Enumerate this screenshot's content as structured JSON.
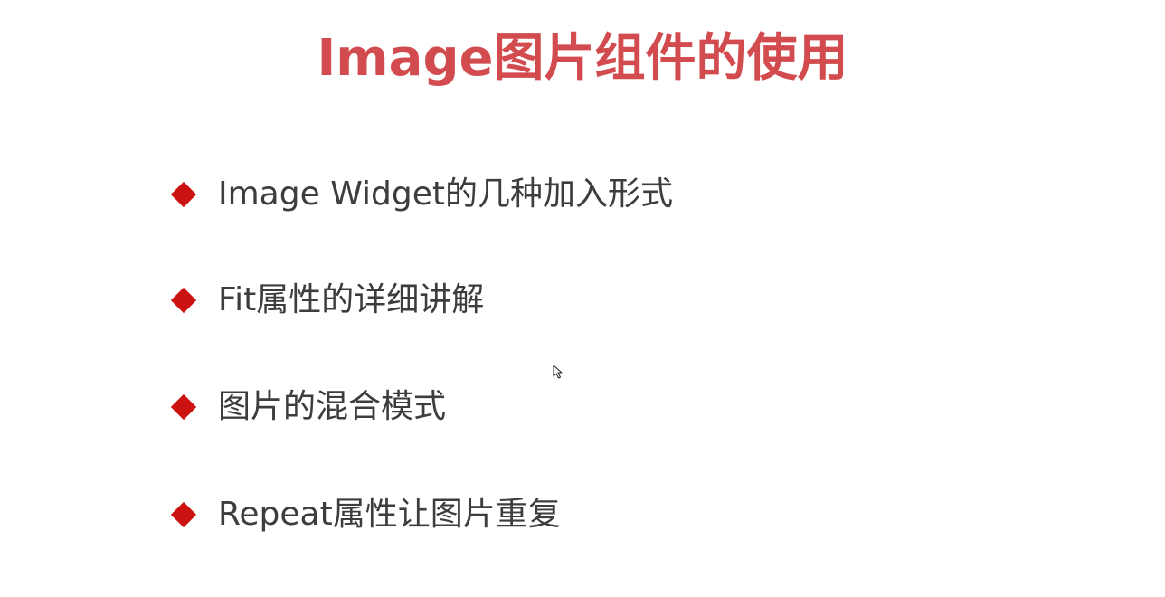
{
  "colors": {
    "title": "#d24b4f",
    "bullet_marker": "#cc1111",
    "bullet_text": "#3d3d3d",
    "background": "#ffffff"
  },
  "slide": {
    "title": "Image图片组件的使用",
    "bullets": [
      {
        "text": "Image Widget的几种加入形式",
        "icon": "diamond-bullet-icon"
      },
      {
        "text": "Fit属性的详细讲解",
        "icon": "diamond-bullet-icon"
      },
      {
        "text": "图片的混合模式",
        "icon": "diamond-bullet-icon"
      },
      {
        "text": "Repeat属性让图片重复",
        "icon": "diamond-bullet-icon"
      }
    ]
  },
  "cursor": {
    "icon": "mouse-pointer-icon"
  }
}
